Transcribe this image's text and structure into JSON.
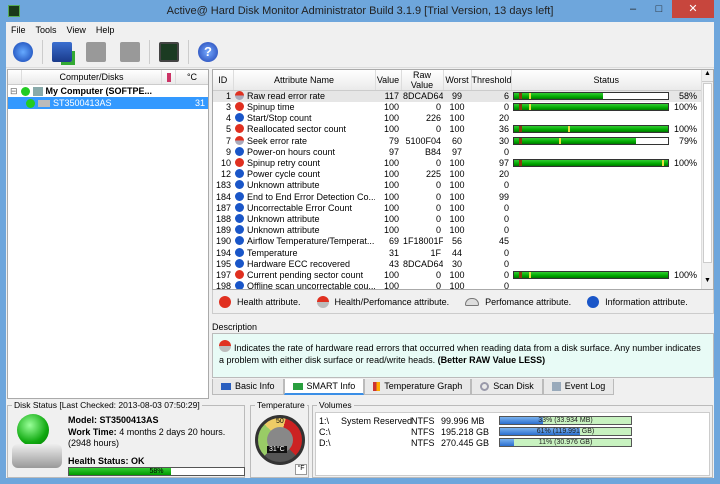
{
  "window": {
    "title": "Active@ Hard Disk Monitor Administrator Build 3.1.9 [Trial Version, 13 days left]",
    "min": "–",
    "max": "□",
    "close": "✕"
  },
  "menu": [
    "File",
    "Tools",
    "View",
    "Help"
  ],
  "toolbar": [
    {
      "icon": "refresh-icon"
    },
    {
      "icon": "add-computer-icon"
    },
    {
      "icon": "computer-settings-icon"
    },
    {
      "icon": "remove-computer-icon"
    },
    {
      "icon": "monitor-settings-icon"
    },
    {
      "icon": "help-icon",
      "label": "?"
    }
  ],
  "tree": {
    "headers": [
      "Computer/Disks",
      "°C"
    ],
    "computer": "My Computer (SOFTPE...",
    "disk": "ST3500413AS",
    "disk_temp": "31",
    "expander": "⊟"
  },
  "smart": {
    "headers": [
      "ID",
      "Attribute Name",
      "Value",
      "Raw Value",
      "Worst",
      "Threshold",
      "Status"
    ],
    "rows": [
      {
        "id": "1",
        "type": "hp",
        "name": "Raw read error rate",
        "value": "117",
        "raw": "8DCAD64",
        "worst": "99",
        "thr": "6",
        "pct": 58,
        "pct_label": "58%",
        "mark": 10
      },
      {
        "id": "3",
        "type": "h",
        "name": "Spinup time",
        "value": "100",
        "raw": "0",
        "worst": "100",
        "thr": "0",
        "pct": 100,
        "pct_label": "100%",
        "mark": 10
      },
      {
        "id": "4",
        "type": "i",
        "name": "Start/Stop count",
        "value": "100",
        "raw": "226",
        "worst": "100",
        "thr": "20"
      },
      {
        "id": "5",
        "type": "h",
        "name": "Reallocated sector count",
        "value": "100",
        "raw": "0",
        "worst": "100",
        "thr": "36",
        "pct": 100,
        "pct_label": "100%",
        "mark": 35
      },
      {
        "id": "7",
        "type": "hp",
        "name": "Seek error rate",
        "value": "79",
        "raw": "5100F04",
        "worst": "60",
        "thr": "30",
        "pct": 79,
        "pct_label": "79%",
        "mark": 29
      },
      {
        "id": "9",
        "type": "i",
        "name": "Power-on hours count",
        "value": "97",
        "raw": "B84",
        "worst": "97",
        "thr": "0"
      },
      {
        "id": "10",
        "type": "h",
        "name": "Spinup retry count",
        "value": "100",
        "raw": "0",
        "worst": "100",
        "thr": "97",
        "pct": 100,
        "pct_label": "100%",
        "mark": 96
      },
      {
        "id": "12",
        "type": "i",
        "name": "Power cycle count",
        "value": "100",
        "raw": "225",
        "worst": "100",
        "thr": "20"
      },
      {
        "id": "183",
        "type": "i",
        "name": "Unknown attribute",
        "value": "100",
        "raw": "0",
        "worst": "100",
        "thr": "0"
      },
      {
        "id": "184",
        "type": "i",
        "name": "End to End Error Detection Co...",
        "value": "100",
        "raw": "0",
        "worst": "100",
        "thr": "99"
      },
      {
        "id": "187",
        "type": "i",
        "name": "Uncorrectable Error Count",
        "value": "100",
        "raw": "0",
        "worst": "100",
        "thr": "0"
      },
      {
        "id": "188",
        "type": "i",
        "name": "Unknown attribute",
        "value": "100",
        "raw": "0",
        "worst": "100",
        "thr": "0"
      },
      {
        "id": "189",
        "type": "i",
        "name": "Unknown attribute",
        "value": "100",
        "raw": "0",
        "worst": "100",
        "thr": "0"
      },
      {
        "id": "190",
        "type": "i",
        "name": "Airflow Temperature/Temperat...",
        "value": "69",
        "raw": "1F18001F",
        "worst": "56",
        "thr": "45"
      },
      {
        "id": "194",
        "type": "i",
        "name": "Temperature",
        "value": "31",
        "raw": "1F",
        "worst": "44",
        "thr": "0"
      },
      {
        "id": "195",
        "type": "i",
        "name": "Hardware ECC recovered",
        "value": "43",
        "raw": "8DCAD64",
        "worst": "30",
        "thr": "0"
      },
      {
        "id": "197",
        "type": "h",
        "name": "Current pending sector count",
        "value": "100",
        "raw": "0",
        "worst": "100",
        "thr": "0",
        "pct": 100,
        "pct_label": "100%",
        "mark": 10
      },
      {
        "id": "198",
        "type": "i",
        "name": "Offline scan uncorrectable cou...",
        "value": "100",
        "raw": "0",
        "worst": "100",
        "thr": "0"
      }
    ]
  },
  "legend": [
    "Health attribute.",
    "Health/Perfomance attribute.",
    "Perfomance attribute.",
    "Information attribute."
  ],
  "description": {
    "label": "Description",
    "text": "Indicates the rate of hardware read errors that occurred when reading data from a disk surface. Any number indicates a problem with either disk surface or read/write heads. ",
    "bold": "(Better RAW Value LESS)"
  },
  "tabs": [
    "Basic Info",
    "SMART Info",
    "Temperature Graph",
    "Scan Disk",
    "Event Log"
  ],
  "disk_status": {
    "title": "Disk Status [Last Checked: 2013-08-03 07:50:29]",
    "model_label": "Model:",
    "model": "ST3500413AS",
    "work_label": "Work Time:",
    "work": "4 months 2 days 20 hours. (2948 hours)",
    "health_label": "Health Status: OK",
    "health_pct": 58,
    "health_pct_label": "58%"
  },
  "temperature": {
    "title": "Temperature",
    "value": "31°C",
    "unit_button": "°F",
    "gauge_label": "50"
  },
  "volumes": {
    "title": "Volumes",
    "rows": [
      {
        "name": "1:\\",
        "label": "System Reserved",
        "fs": "NTFS",
        "size": "99.996 MB",
        "pct": 33,
        "bar": "33% (33.934 MB)"
      },
      {
        "name": "C:\\",
        "label": "",
        "fs": "NTFS",
        "size": "195.218 GB",
        "pct": 61,
        "bar": "61% (119.991 GB)"
      },
      {
        "name": "D:\\",
        "label": "",
        "fs": "NTFS",
        "size": "270.445 GB",
        "pct": 11,
        "bar": "11% (30.976 GB)"
      }
    ]
  },
  "colors": {
    "health": "#e03020",
    "info": "#1a56c8",
    "bar_green": "#00aa00",
    "selection": "#3399ff"
  }
}
